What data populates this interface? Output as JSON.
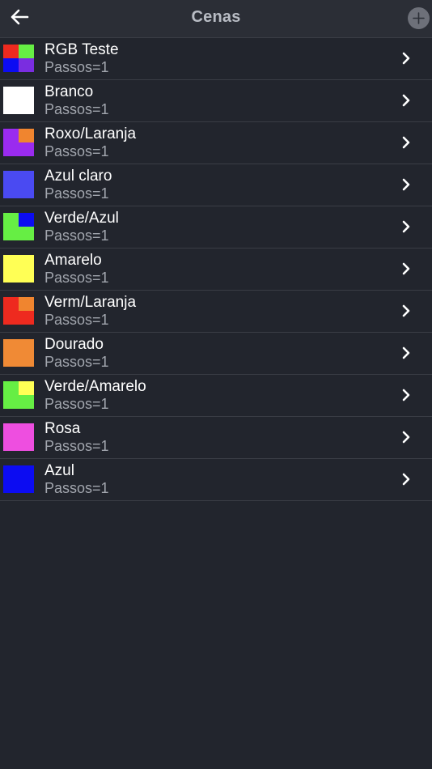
{
  "navbar": {
    "title": "Cenas",
    "back_icon": "arrow-left-icon",
    "add_icon": "plus-icon"
  },
  "scenes": [
    {
      "name": "RGB Teste",
      "subtitle": "Passos=1",
      "swatch": {
        "type": "quad",
        "colors": [
          "#ee2a1f",
          "#66ee44",
          "#0c0cf2",
          "#7a2de0"
        ]
      }
    },
    {
      "name": "Branco",
      "subtitle": "Passos=1",
      "swatch": {
        "type": "solid",
        "colors": [
          "#ffffff"
        ]
      }
    },
    {
      "name": "Roxo/Laranja",
      "subtitle": "Passos=1",
      "swatch": {
        "type": "corner",
        "colors": [
          "#9a2bef",
          "#f0852f"
        ]
      }
    },
    {
      "name": "Azul claro",
      "subtitle": "Passos=1",
      "swatch": {
        "type": "solid",
        "colors": [
          "#4a4af2"
        ]
      }
    },
    {
      "name": "Verde/Azul",
      "subtitle": "Passos=1",
      "swatch": {
        "type": "corner",
        "colors": [
          "#66ee44",
          "#0c0cf2"
        ]
      }
    },
    {
      "name": "Amarelo",
      "subtitle": "Passos=1",
      "swatch": {
        "type": "solid",
        "colors": [
          "#ffff55"
        ]
      }
    },
    {
      "name": "Verm/Laranja",
      "subtitle": "Passos=1",
      "swatch": {
        "type": "corner",
        "colors": [
          "#ee2a1f",
          "#f0852f"
        ]
      }
    },
    {
      "name": "Dourado",
      "subtitle": "Passos=1",
      "swatch": {
        "type": "solid",
        "colors": [
          "#f08a35"
        ]
      }
    },
    {
      "name": "Verde/Amarelo",
      "subtitle": "Passos=1",
      "swatch": {
        "type": "corner",
        "colors": [
          "#66ee44",
          "#ffff55"
        ]
      }
    },
    {
      "name": "Rosa",
      "subtitle": "Passos=1",
      "swatch": {
        "type": "solid",
        "colors": [
          "#ee4ee0"
        ]
      }
    },
    {
      "name": "Azul",
      "subtitle": "Passos=1",
      "swatch": {
        "type": "solid",
        "colors": [
          "#0c0cf2"
        ]
      }
    }
  ],
  "row_chevron_icon": "chevron-right-icon",
  "colors": {
    "background": "#22252d",
    "navbar": "#2b2e36",
    "separator": "#3a3d45",
    "title_text": "#b8bcc4",
    "primary_text": "#ffffff",
    "secondary_text": "#a2a6ae"
  }
}
